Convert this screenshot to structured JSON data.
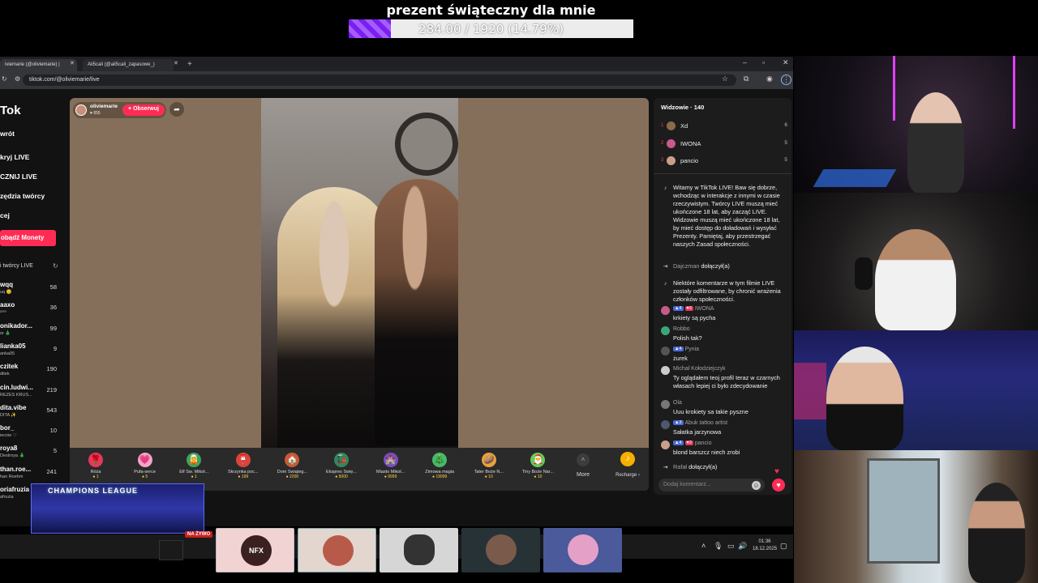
{
  "goal": {
    "title": "prezent świąteczny dla mnie",
    "progress_text": "284.00 / 1920 (14.79%)",
    "progress": 0.1479
  },
  "browser": {
    "tabs": [
      {
        "label": "iviemarie (@oliviemarie) |"
      },
      {
        "label": "Ali5cali (@ali5cali_zapasowe_)"
      }
    ],
    "url": "tiktok.com/@oliviemarie/live"
  },
  "sidebar": {
    "logo": "Tok",
    "nav": [
      "wrót",
      "kryj LIVE",
      "CZNIJ LIVE",
      "zędzia twórcy",
      "cej"
    ],
    "coins_button": "obądź Monety",
    "section_title": "i twórcy LIVE",
    "creators": [
      {
        "name": "wqq",
        "sub": "uq 😊",
        "count": "58"
      },
      {
        "name": "aaxo",
        "sub": "ᵖᵃˣᵒ",
        "count": "36"
      },
      {
        "name": "onikador...",
        "sub": "or 🎄",
        "count": "99"
      },
      {
        "name": "lianka05",
        "sub": "anka05",
        "count": "9"
      },
      {
        "name": "czitek",
        "sub": "ditek",
        "count": "190"
      },
      {
        "name": "cin.ludwi...",
        "sub": "REZES KRUS...",
        "count": "219"
      },
      {
        "name": "dita.vibe",
        "sub": "DITA ✨",
        "count": "543"
      },
      {
        "name": "bor_",
        "sub": "iecnie ♡",
        "count": "10"
      },
      {
        "name": "roya8",
        "sub": "Destroya 🎄",
        "count": "5"
      },
      {
        "name": "than.roe...",
        "sub": "han Roehm",
        "count": "241"
      },
      {
        "name": "oriafruzia",
        "sub": "afruzia",
        "count": ""
      }
    ]
  },
  "player": {
    "host_name": "oliviemarie",
    "host_likes": "♥ 655",
    "follow_label": "+ Obserwuj",
    "share_icon": "share-icon",
    "gifts": [
      {
        "name": "Róża",
        "price": "1",
        "color": "#e6385c",
        "icon": "🌹"
      },
      {
        "name": "Pufa-serce",
        "price": "5",
        "color": "#f4a3c9",
        "icon": "💗"
      },
      {
        "name": "Elf Św. Mikoł...",
        "price": "1",
        "color": "#3aa65a",
        "icon": "🧝"
      },
      {
        "name": "Skrzynka poc...",
        "price": "199",
        "color": "#d8453a",
        "icon": "📮"
      },
      {
        "name": "Dom Świąteg...",
        "price": "2200",
        "color": "#c8583a",
        "icon": "🏠"
      },
      {
        "name": "Ekspres Świę...",
        "price": "5000",
        "color": "#2d8a5a",
        "icon": "🚂"
      },
      {
        "name": "Miasto Mikoł...",
        "price": "9999",
        "color": "#7a4ac8",
        "icon": "🏰"
      },
      {
        "name": "Zimowa magia",
        "price": "19999",
        "color": "#4ab86a",
        "icon": "🎄"
      },
      {
        "name": "Tater Boże N...",
        "price": "10",
        "color": "#e8a23a",
        "icon": "🥔"
      },
      {
        "name": "Tiny Boże Nar...",
        "price": "10",
        "color": "#6bc85a",
        "icon": "🎅"
      }
    ],
    "more_label": "More",
    "recharge_label": "Recharge ›"
  },
  "chat": {
    "viewers_title": "Widzowie · 140",
    "viewers": [
      {
        "rank": "1",
        "name": "Xd",
        "score": "6",
        "color": "#8a6a4a"
      },
      {
        "rank": "2",
        "name": "IWONA",
        "score": "5",
        "color": "#c85a8a"
      },
      {
        "rank": "3",
        "name": "pancio",
        "score": "5",
        "color": "#c8a08a"
      }
    ],
    "messages": [
      {
        "name": "",
        "body": "Witamy w TikTok LIVE! Baw się dobrze, wchodząc w interakcje z innymi w czasie rzeczywistym. Twórcy LIVE muszą mieć ukończone 18 lat, aby zacząć LIVE. Widzowie muszą mieć ukończone 18 lat, by mieć dostęp do doładowań i wysyłać Prezenty. Pamiętaj, aby przestrzegać naszych Zasad społeczności.",
        "type": "system"
      },
      {
        "name": "Dajczman",
        "body": "dołączył(a)",
        "type": "join"
      },
      {
        "name": "",
        "body": "Niektóre komentarze w tym filmie LIVE zostały odfiltrowane, by chronić wrażenia członków społeczności.",
        "type": "system"
      },
      {
        "name": "IWONA",
        "badge": "4",
        "badge2": "3",
        "body": "krkiety są pycha",
        "type": "chat"
      },
      {
        "name": "Robbo",
        "body": "Polish tak?",
        "type": "chat"
      },
      {
        "name": "Pynia",
        "badge": "4",
        "body": "żurek",
        "type": "chat"
      },
      {
        "name": "Michał Kołodziejczyk",
        "body": "Ty oglądałem teoj profil teraz w czarnych własach lepiej ci było zdecydowanie",
        "type": "chat"
      },
      {
        "name": "Ola",
        "body": "Uuu krokiety sa takie pyszne",
        "type": "chat"
      },
      {
        "name": "Abuk tattoo artist",
        "badge": "3",
        "body": "Sałatka jarzynowa",
        "type": "chat"
      },
      {
        "name": "pancio",
        "badge": "4",
        "badge2": "3",
        "body": "blond barszcz niech zrobi",
        "type": "chat"
      },
      {
        "name": "Rafał",
        "body": "dołączył(a)",
        "type": "join"
      }
    ],
    "input_placeholder": "Dodaj komentarz..."
  },
  "taskbar": {
    "time": "01:36",
    "date": "18.12.2025"
  },
  "overlay": {
    "champions": "CHAMPIONS LEAGUE",
    "live_tag": "NA ŻYWO",
    "nfx_label": "NFX"
  }
}
